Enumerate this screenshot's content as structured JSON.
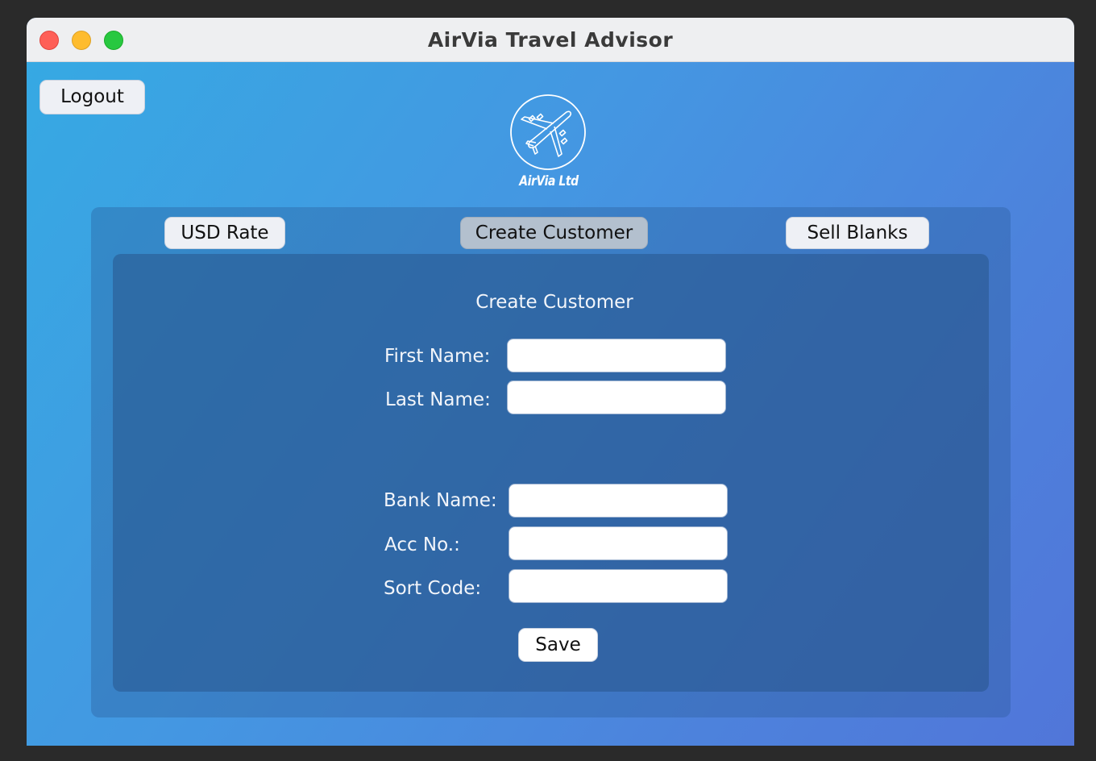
{
  "window": {
    "title": "AirVia Travel Advisor"
  },
  "header": {
    "logout_label": "Logout",
    "logo_text": "AirVia Ltd"
  },
  "tabs": [
    {
      "label": "USD Rate",
      "selected": false
    },
    {
      "label": "Create Customer",
      "selected": true
    },
    {
      "label": "Sell Blanks",
      "selected": false
    }
  ],
  "form": {
    "title": "Create Customer",
    "first_name": {
      "label": "First Name:",
      "value": ""
    },
    "last_name": {
      "label": "Last Name:",
      "value": ""
    },
    "bank_name": {
      "label": "Bank Name:",
      "value": ""
    },
    "acc_no": {
      "label": "Acc No.:",
      "value": ""
    },
    "sort_code": {
      "label": "Sort Code:",
      "value": ""
    },
    "save_label": "Save"
  },
  "colors": {
    "gradient_start": "#36a9e3",
    "gradient_end": "#5176d9",
    "selected_tab": "#b3c0ce",
    "traffic_close": "#fe5f57",
    "traffic_min": "#febc2e",
    "traffic_max": "#28c840"
  }
}
